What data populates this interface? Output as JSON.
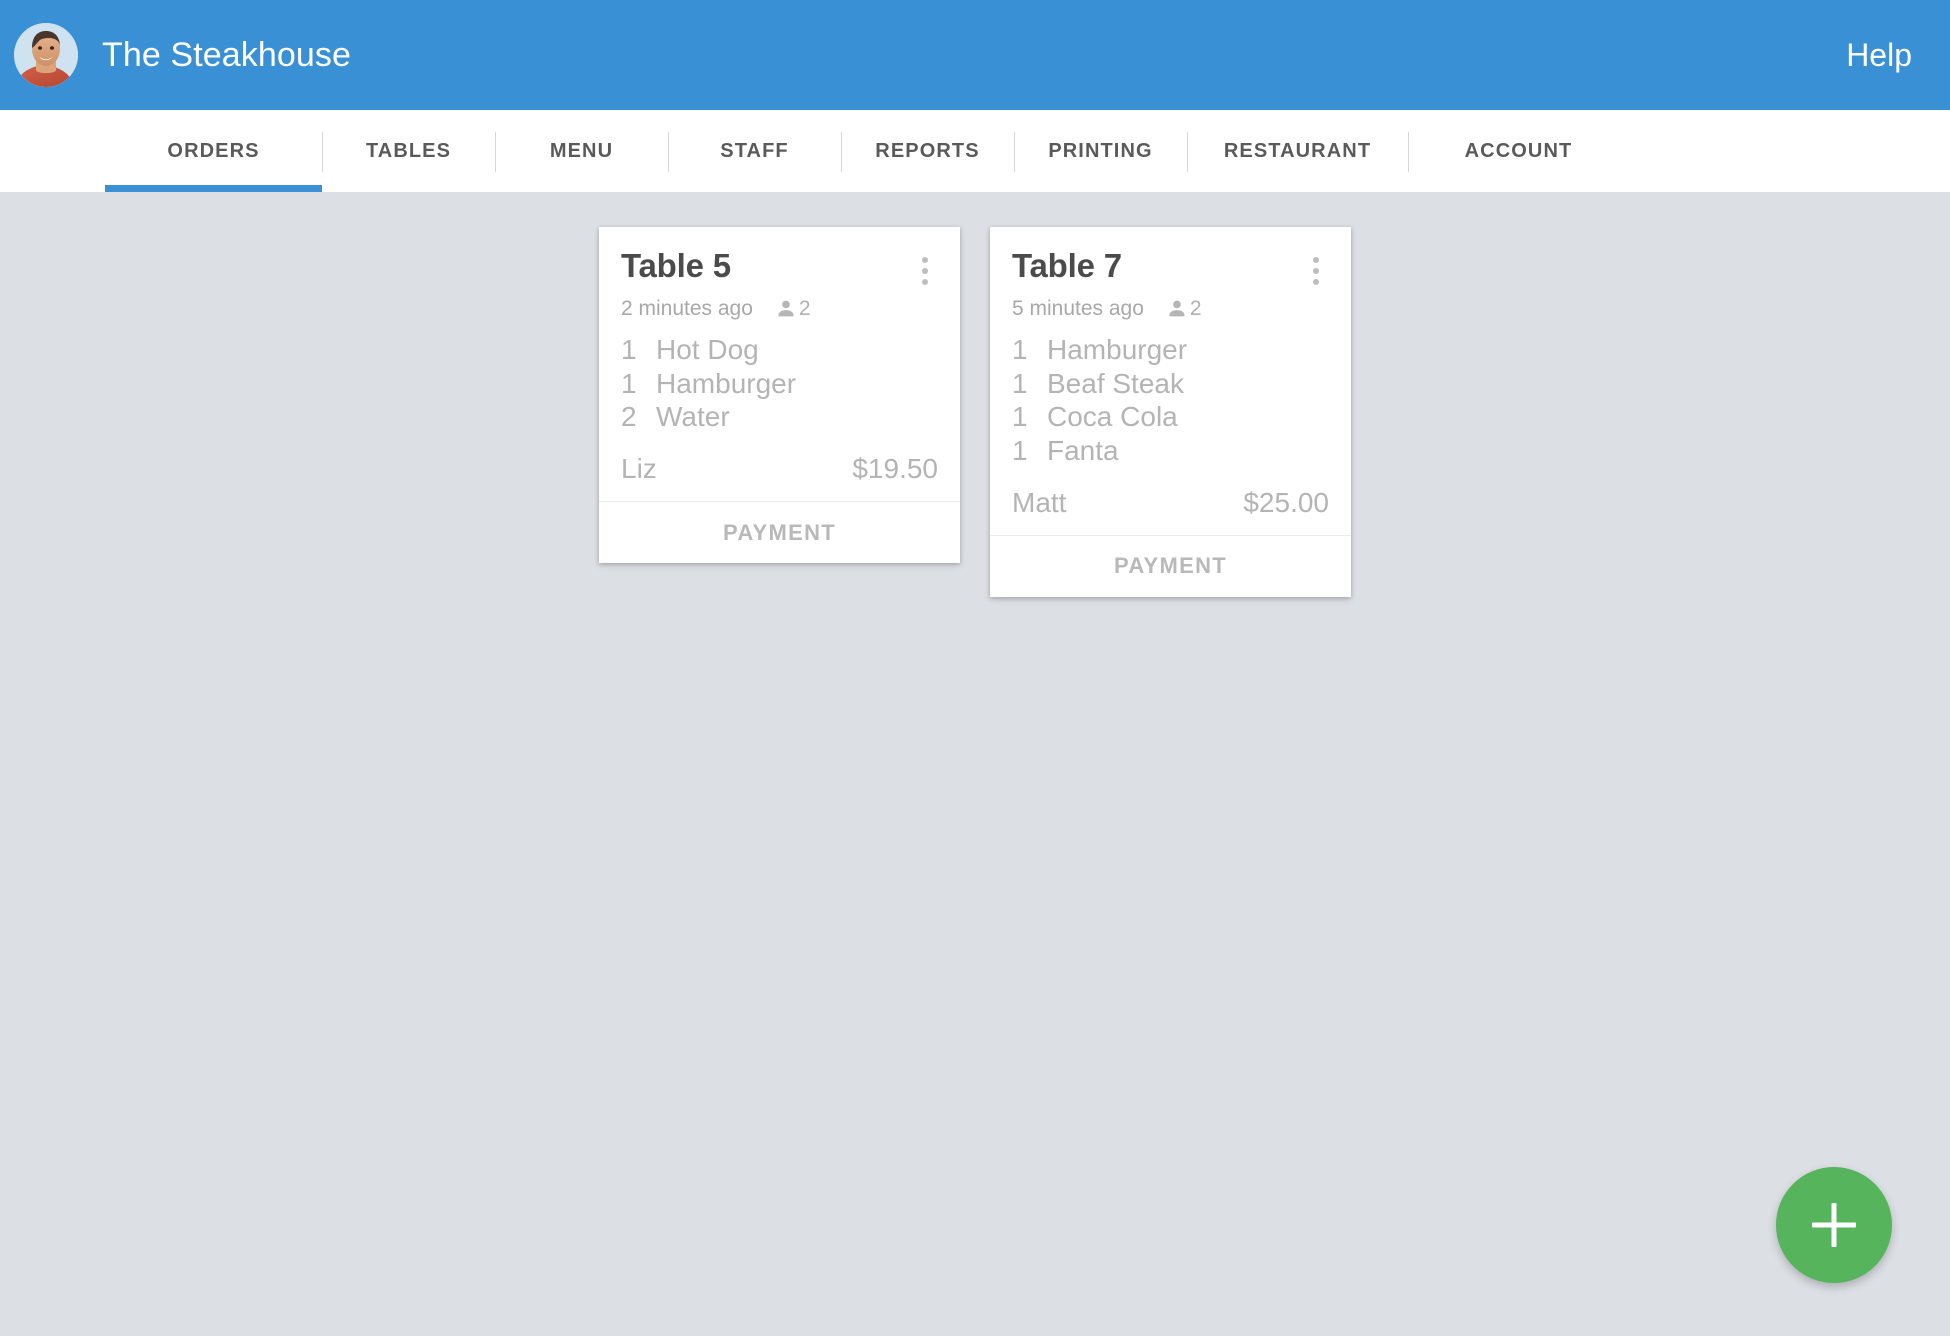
{
  "header": {
    "restaurant_name": "The Steakhouse",
    "help_label": "Help",
    "avatar_icon": "user-avatar-photo",
    "background_color": "#3a90d4"
  },
  "nav": {
    "active_tab": "ORDERS",
    "active_indicator_color": "#3a90d4",
    "tabs": [
      {
        "label": "ORDERS",
        "key": "orders",
        "active": true
      },
      {
        "label": "TABLES",
        "key": "tables",
        "active": false
      },
      {
        "label": "MENU",
        "key": "menu",
        "active": false
      },
      {
        "label": "STAFF",
        "key": "staff",
        "active": false
      },
      {
        "label": "REPORTS",
        "key": "reports",
        "active": false
      },
      {
        "label": "PRINTING",
        "key": "printing",
        "active": false
      },
      {
        "label": "RESTAURANT",
        "key": "restaurant",
        "active": false
      },
      {
        "label": "ACCOUNT",
        "key": "account",
        "active": false
      }
    ]
  },
  "orders": [
    {
      "table_title": "Table 5",
      "elapsed": "2 minutes ago",
      "guest_icon": "person-icon",
      "guest_count": "2",
      "menu_icon": "kebab-menu-icon",
      "items": [
        {
          "qty": "1",
          "name": "Hot Dog"
        },
        {
          "qty": "1",
          "name": "Hamburger"
        },
        {
          "qty": "2",
          "name": "Water"
        }
      ],
      "waiter": "Liz",
      "total": "$19.50",
      "payment_label": "PAYMENT"
    },
    {
      "table_title": "Table 7",
      "elapsed": "5 minutes ago",
      "guest_icon": "person-icon",
      "guest_count": "2",
      "menu_icon": "kebab-menu-icon",
      "items": [
        {
          "qty": "1",
          "name": "Hamburger"
        },
        {
          "qty": "1",
          "name": "Beaf Steak"
        },
        {
          "qty": "1",
          "name": "Coca Cola"
        },
        {
          "qty": "1",
          "name": "Fanta"
        }
      ],
      "waiter": "Matt",
      "total": "$25.00",
      "payment_label": "PAYMENT"
    }
  ],
  "fab": {
    "icon": "plus-icon",
    "color": "#56b45c"
  },
  "page": {
    "background_color": "#dce0e4"
  }
}
